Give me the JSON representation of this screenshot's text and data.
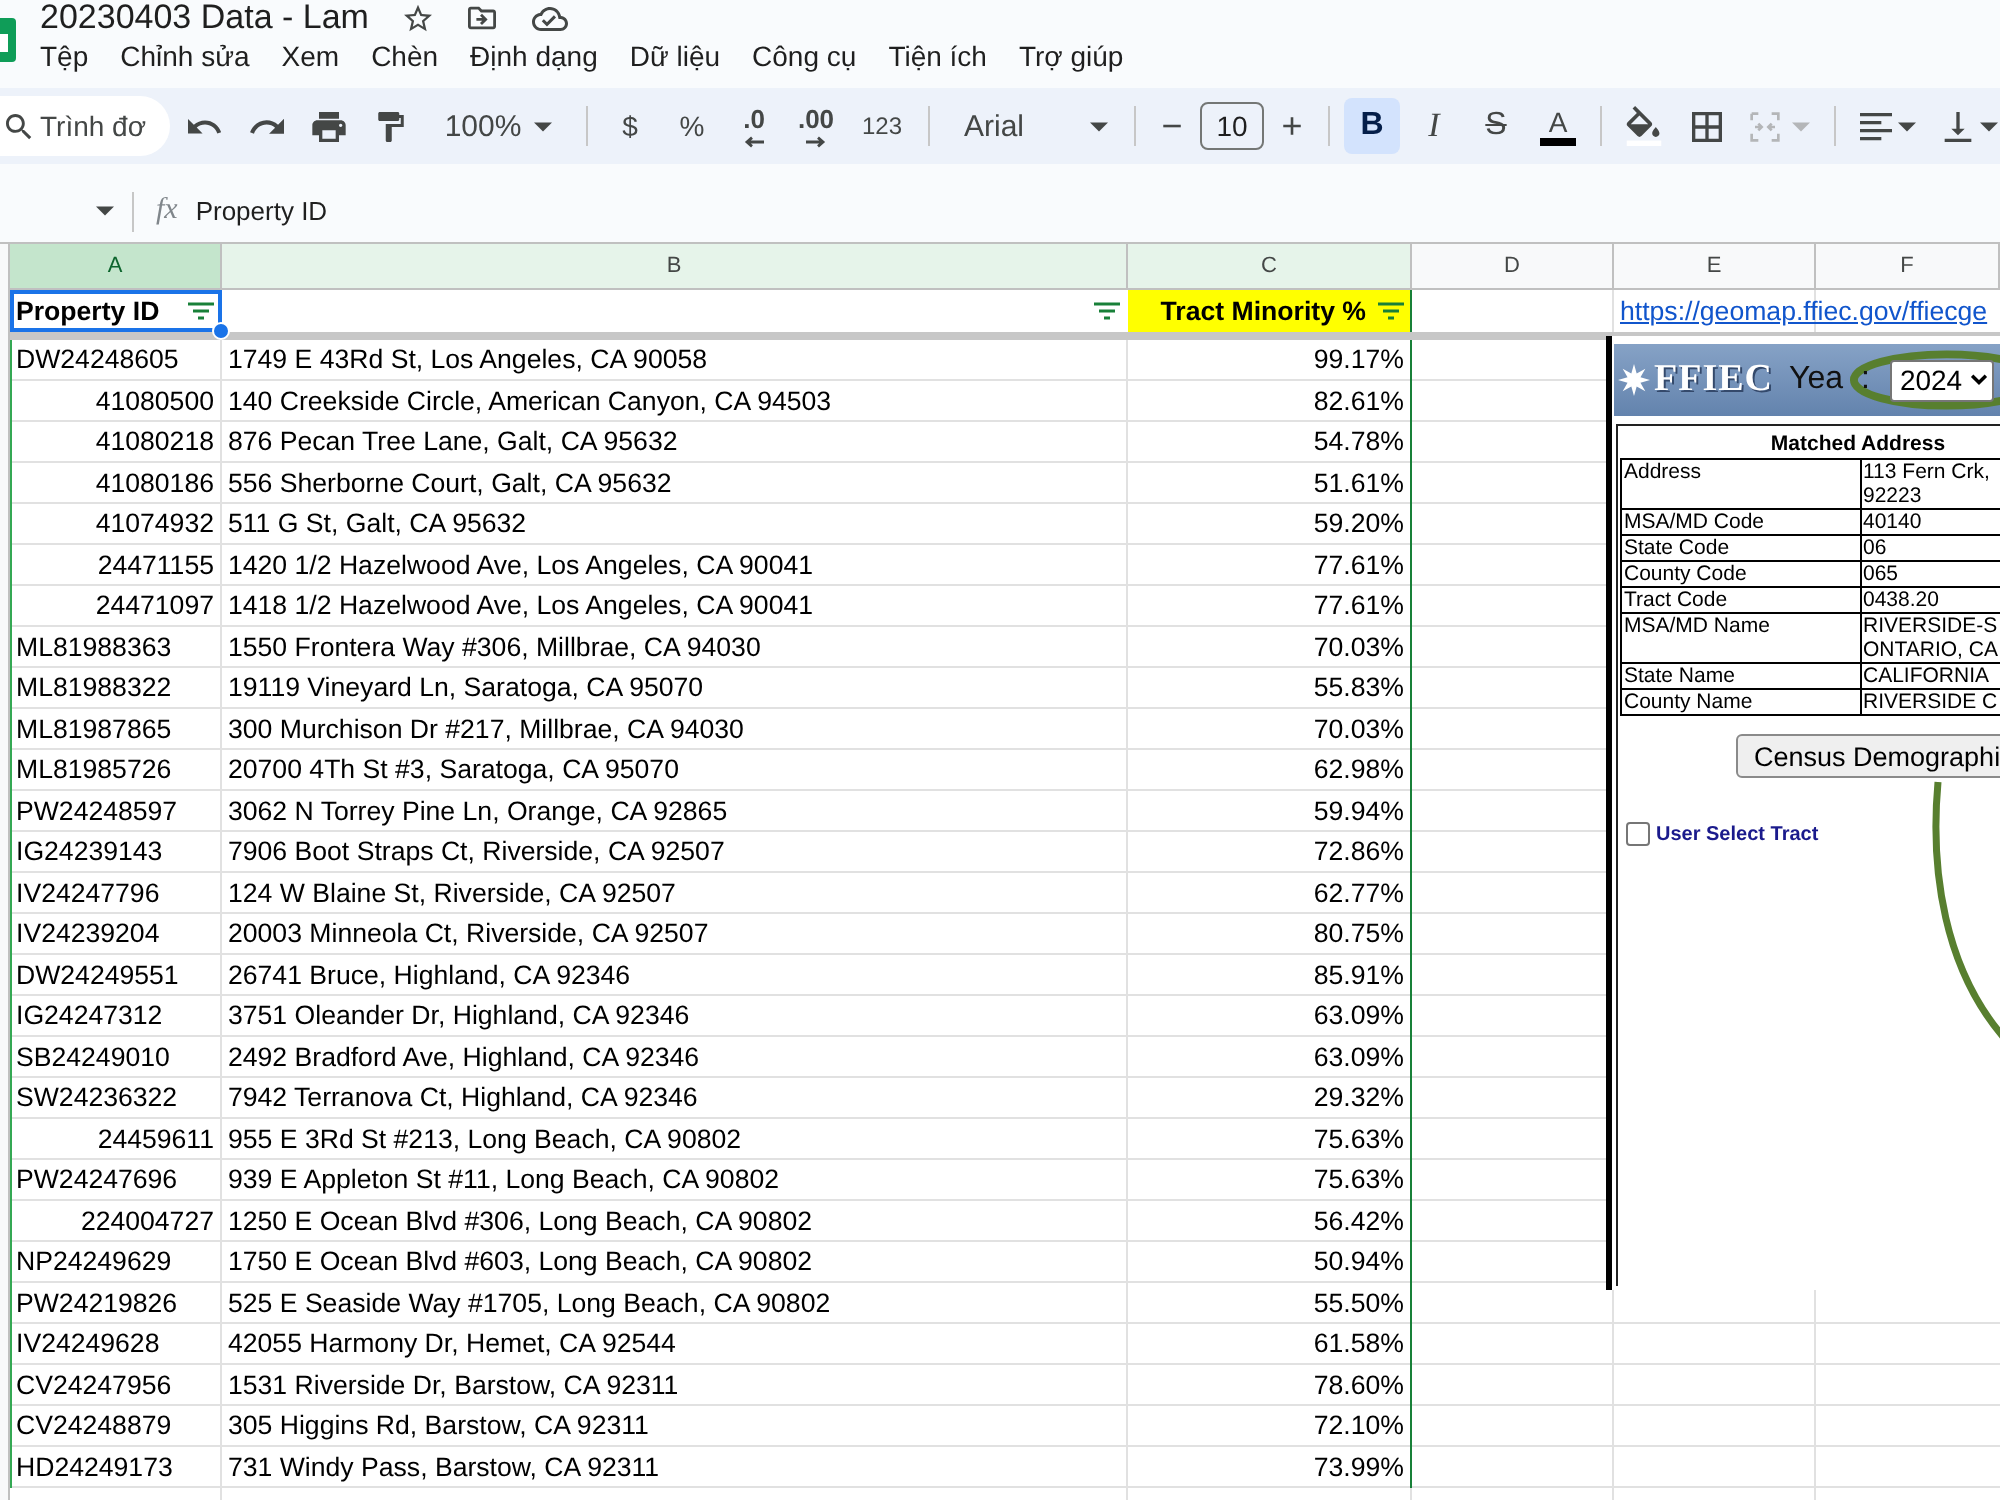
{
  "window": {
    "title": "20230403 Data - Lam"
  },
  "menu": [
    "Tệp",
    "Chỉnh sửa",
    "Xem",
    "Chèn",
    "Định dạng",
    "Dữ liệu",
    "Công cụ",
    "Tiện ích",
    "Trợ giúp"
  ],
  "toolbar": {
    "search": {
      "placeholder": "Trình đơ"
    },
    "zoom": "100%",
    "currency": "$",
    "percent": "%",
    "decrease_decimal": ".0",
    "increase_decimal": ".00",
    "more_formats": "123",
    "font": "Arial",
    "font_size": {
      "minus": "−",
      "value": "10",
      "plus": "+"
    },
    "bold": {
      "label": "B",
      "on": true
    },
    "italic": {
      "label": "I",
      "on": false
    },
    "strikethrough": {
      "label": "S",
      "on": false
    },
    "text_color": {
      "label": "A"
    },
    "merge": {
      "disabled": true
    }
  },
  "formula_bar": {
    "fx": "fx",
    "formula": "Property ID"
  },
  "sheet": {
    "columns": [
      {
        "letter": "A",
        "selected": true,
        "filtered": true
      },
      {
        "letter": "B",
        "selected": false,
        "filtered": true
      },
      {
        "letter": "C",
        "selected": false,
        "filtered": true
      },
      {
        "letter": "D",
        "selected": false,
        "filtered": false
      },
      {
        "letter": "E",
        "selected": false,
        "filtered": false
      },
      {
        "letter": "F",
        "selected": false,
        "filtered": false
      }
    ],
    "header_cells": [
      {
        "text": "Property ID",
        "filter": true,
        "selected": true,
        "highlighted": false
      },
      {
        "filter": true,
        "selected": false,
        "highlighted": false
      },
      {
        "text": "Tract Minority %",
        "filter": true,
        "selected": false,
        "highlighted": true
      }
    ],
    "link": "https://geomap.ffiec.gov/ffiecge",
    "rows": [
      {
        "kind": "text",
        "property_id": "DW24248605",
        "column_2": "1749 E 43Rd St, Los Angeles, CA 90058",
        "tract_minority": "99.17%"
      },
      {
        "kind": "number",
        "property_id": "41080500",
        "column_2": "140 Creekside Circle, American Canyon, CA 94503",
        "tract_minority": "82.61%"
      },
      {
        "kind": "number",
        "property_id": "41080218",
        "column_2": "876 Pecan Tree Lane, Galt, CA 95632",
        "tract_minority": "54.78%"
      },
      {
        "kind": "number",
        "property_id": "41080186",
        "column_2": "556 Sherborne Court, Galt, CA 95632",
        "tract_minority": "51.61%"
      },
      {
        "kind": "number",
        "property_id": "41074932",
        "column_2": "511 G St, Galt, CA 95632",
        "tract_minority": "59.20%"
      },
      {
        "kind": "number",
        "property_id": "24471155",
        "column_2": "1420 1/2 Hazelwood Ave, Los Angeles, CA 90041",
        "tract_minority": "77.61%"
      },
      {
        "kind": "number",
        "property_id": "24471097",
        "column_2": "1418 1/2 Hazelwood Ave, Los Angeles, CA 90041",
        "tract_minority": "77.61%"
      },
      {
        "kind": "text",
        "property_id": "ML81988363",
        "column_2": "1550 Frontera Way #306, Millbrae, CA 94030",
        "tract_minority": "70.03%"
      },
      {
        "kind": "text",
        "property_id": "ML81988322",
        "column_2": "19119 Vineyard Ln, Saratoga, CA 95070",
        "tract_minority": "55.83%"
      },
      {
        "kind": "text",
        "property_id": "ML81987865",
        "column_2": "300 Murchison Dr #217, Millbrae, CA 94030",
        "tract_minority": "70.03%"
      },
      {
        "kind": "text",
        "property_id": "ML81985726",
        "column_2": "20700 4Th St #3, Saratoga, CA 95070",
        "tract_minority": "62.98%"
      },
      {
        "kind": "text",
        "property_id": "PW24248597",
        "column_2": "3062 N Torrey Pine Ln, Orange, CA 92865",
        "tract_minority": "59.94%"
      },
      {
        "kind": "text",
        "property_id": "IG24239143",
        "column_2": "7906 Boot Straps Ct, Riverside, CA 92507",
        "tract_minority": "72.86%"
      },
      {
        "kind": "text",
        "property_id": "IV24247796",
        "column_2": "124 W Blaine St, Riverside, CA 92507",
        "tract_minority": "62.77%"
      },
      {
        "kind": "text",
        "property_id": "IV24239204",
        "column_2": "20003 Minneola Ct, Riverside, CA 92507",
        "tract_minority": "80.75%"
      },
      {
        "kind": "text",
        "property_id": "DW24249551",
        "column_2": "26741 Bruce, Highland, CA 92346",
        "tract_minority": "85.91%"
      },
      {
        "kind": "text",
        "property_id": "IG24247312",
        "column_2": "3751 Oleander Dr, Highland, CA 92346",
        "tract_minority": "63.09%"
      },
      {
        "kind": "text",
        "property_id": "SB24249010",
        "column_2": "2492 Bradford Ave, Highland, CA 92346",
        "tract_minority": "63.09%"
      },
      {
        "kind": "text",
        "property_id": "SW24236322",
        "column_2": "7942 Terranova Ct, Highland, CA 92346",
        "tract_minority": "29.32%"
      },
      {
        "kind": "number",
        "property_id": "24459611",
        "column_2": "955 E 3Rd St #213, Long Beach, CA 90802",
        "tract_minority": "75.63%"
      },
      {
        "kind": "text",
        "property_id": "PW24247696",
        "column_2": "939 E Appleton St #11, Long Beach, CA 90802",
        "tract_minority": "75.63%"
      },
      {
        "kind": "number",
        "property_id": "224004727",
        "column_2": "1250 E Ocean Blvd #306, Long Beach, CA 90802",
        "tract_minority": "56.42%"
      },
      {
        "kind": "text",
        "property_id": "NP24249629",
        "column_2": "1750 E Ocean Blvd #603, Long Beach, CA 90802",
        "tract_minority": "50.94%"
      },
      {
        "kind": "text",
        "property_id": "PW24219826",
        "column_2": "525 E Seaside Way #1705, Long Beach, CA 90802",
        "tract_minority": "55.50%"
      },
      {
        "kind": "text",
        "property_id": "IV24249628",
        "column_2": "42055 Harmony Dr, Hemet, CA 92544",
        "tract_minority": "61.58%"
      },
      {
        "kind": "text",
        "property_id": "CV24247956",
        "column_2": "1531 Riverside Dr, Barstow, CA 92311",
        "tract_minority": "78.60%"
      },
      {
        "kind": "text",
        "property_id": "CV24248879",
        "column_2": "305 Higgins Rd, Barstow, CA 92311",
        "tract_minority": "72.10%"
      },
      {
        "kind": "text",
        "property_id": "HD24249173",
        "column_2": "731 Windy Pass, Barstow, CA 92311",
        "tract_minority": "73.99%"
      }
    ]
  },
  "ffiec_panel": {
    "logo": "FFIEC",
    "year_label": "Yea",
    "year_colon": ":",
    "year": "2024",
    "heading": "Matched Address",
    "fields": [
      {
        "label": "Address",
        "value_lines": [
          "113 Fern Crk,",
          "92223"
        ]
      },
      {
        "label": "MSA/MD Code",
        "value_lines": [
          "40140"
        ]
      },
      {
        "label": "State Code",
        "value_lines": [
          "06"
        ]
      },
      {
        "label": "County Code",
        "value_lines": [
          "065"
        ]
      },
      {
        "label": "Tract Code",
        "value_lines": [
          "0438.20"
        ]
      },
      {
        "label": "MSA/MD Name",
        "value_lines": [
          "RIVERSIDE-S",
          "ONTARIO, CA"
        ]
      },
      {
        "label": "State Name",
        "value_lines": [
          "CALIFORNIA"
        ]
      },
      {
        "label": "County Name",
        "value_lines": [
          "RIVERSIDE C"
        ]
      }
    ],
    "button": "Census Demographi",
    "user_select_tract": {
      "label": "User Select Tract",
      "checked": false
    }
  }
}
